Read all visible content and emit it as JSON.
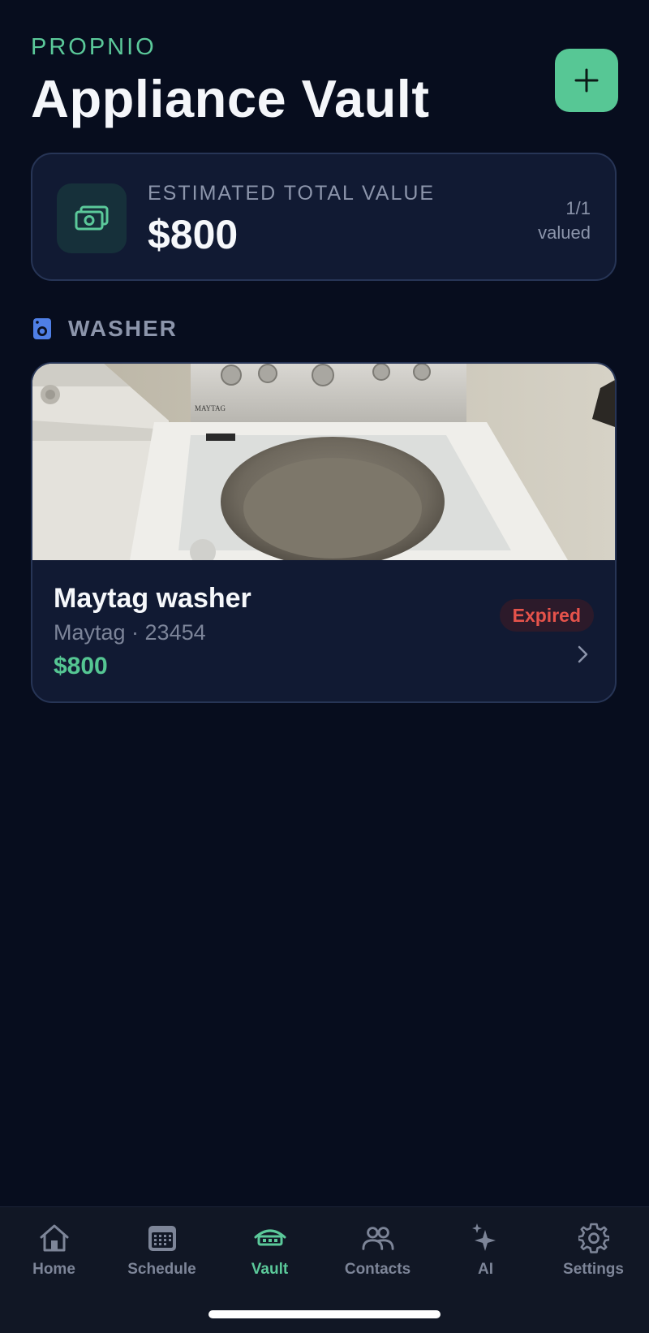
{
  "header": {
    "brand": "PROPNIO",
    "title": "Appliance Vault",
    "add_icon": "plus-icon"
  },
  "summary": {
    "label": "ESTIMATED TOTAL VALUE",
    "value": "$800",
    "count": "1/1",
    "count_caption": "valued",
    "icon": "money-icon"
  },
  "section": {
    "title": "WASHER",
    "icon": "washer-icon"
  },
  "items": [
    {
      "name": "Maytag washer",
      "meta": "Maytag · 23454",
      "price": "$800",
      "status": "Expired",
      "photo_brand_text": "MAYTAG"
    }
  ],
  "tabs": [
    {
      "label": "Home",
      "icon": "home-icon",
      "active": false
    },
    {
      "label": "Schedule",
      "icon": "calendar-icon",
      "active": false
    },
    {
      "label": "Vault",
      "icon": "vault-house-icon",
      "active": true
    },
    {
      "label": "Contacts",
      "icon": "people-icon",
      "active": false
    },
    {
      "label": "AI",
      "icon": "sparkles-icon",
      "active": false
    },
    {
      "label": "Settings",
      "icon": "gear-icon",
      "active": false
    }
  ],
  "colors": {
    "background": "#070d1e",
    "accent": "#57c795",
    "card": "#111a33",
    "danger": "#e5534b",
    "muted": "#8c95ab"
  }
}
